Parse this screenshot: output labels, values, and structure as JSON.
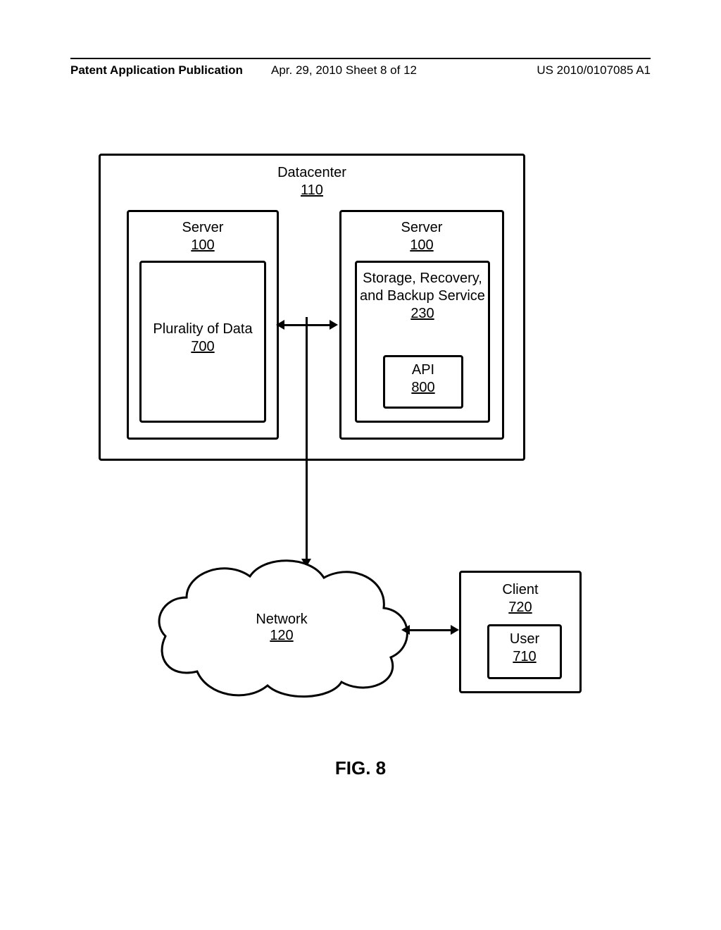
{
  "header": {
    "left": "Patent Application Publication",
    "middle": "Apr. 29, 2010  Sheet 8 of 12",
    "right": "US 2010/0107085 A1"
  },
  "datacenter": {
    "name": "Datacenter",
    "num": "110"
  },
  "server_left": {
    "name": "Server",
    "num": "100"
  },
  "plurality": {
    "name": "Plurality of Data",
    "num": "700"
  },
  "server_right": {
    "name": "Server",
    "num": "100"
  },
  "srb": {
    "name": "Storage, Recovery, and Backup Service",
    "num": "230"
  },
  "api": {
    "name": "API",
    "num": "800"
  },
  "network": {
    "name": "Network",
    "num": "120"
  },
  "client": {
    "name": "Client",
    "num": "720"
  },
  "user": {
    "name": "User",
    "num": "710"
  },
  "figure": "FIG. 8"
}
